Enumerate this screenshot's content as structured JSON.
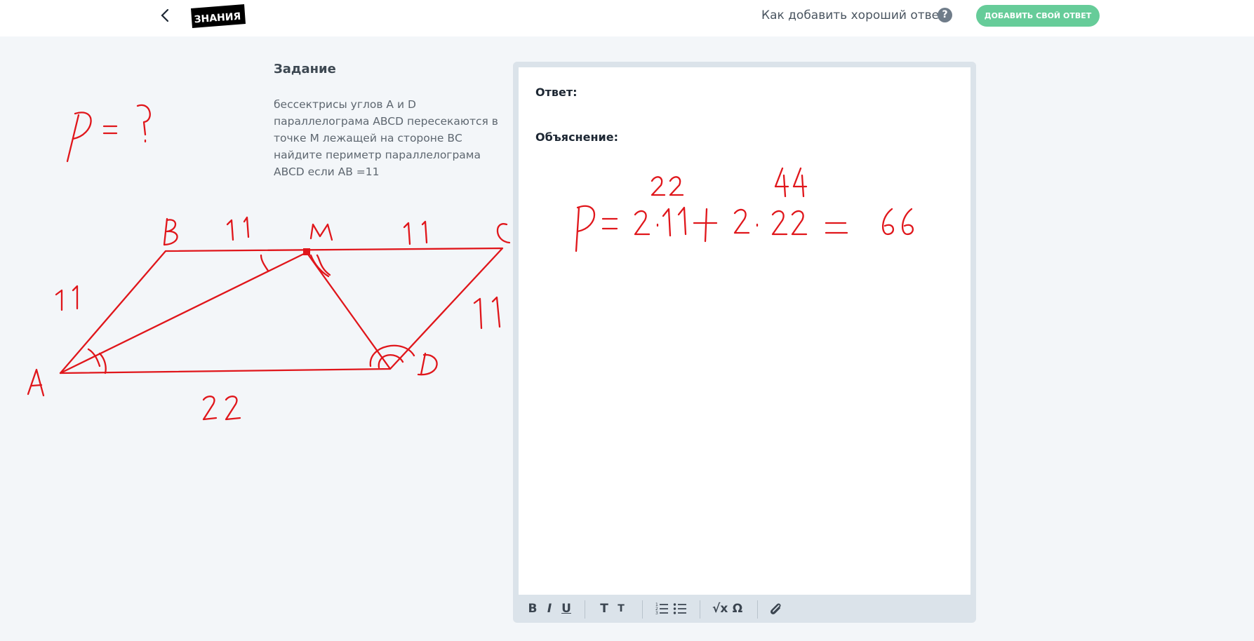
{
  "header": {
    "back_icon": "chevron-left-icon",
    "logo_text": "ЗНАНИЯ",
    "help_link": "Как добавить хороший ответ",
    "help_icon": "?",
    "add_button": "ДОБАВИТЬ СВОЙ ОТВЕТ"
  },
  "task": {
    "title": "Задание",
    "text": "бессектрисы углов А и D параллелограма ABCD пересекаются в точке М лежащей на стороне ВС найдите периметр параллелограма ABCD если АВ =11"
  },
  "drawing": {
    "formula": "P = ?",
    "vertices": [
      "A",
      "B",
      "M",
      "C",
      "D"
    ],
    "lengths": [
      "11",
      "11",
      "11",
      "11",
      "22"
    ]
  },
  "editor": {
    "answer_label": "Ответ:",
    "explanation_label": "Объяснение:",
    "handwriting": {
      "line": [
        "P",
        "=",
        "2",
        "·",
        "11",
        "+",
        "2",
        "·",
        "22",
        "=",
        "66"
      ],
      "above": [
        "22",
        "44"
      ]
    },
    "toolbar": {
      "bold": "B",
      "italic": "I",
      "underline": "U",
      "text_large": "T",
      "text_small": "T",
      "math": "√x",
      "symbol": "Ω",
      "ordered_list_icon": "ordered-list-icon",
      "bullet_list_icon": "bullet-list-icon",
      "attach_icon": "paperclip-icon"
    }
  },
  "colors": {
    "accent_button": "#66cc99",
    "ink": "#e0161b",
    "background": "#f3f6f9"
  }
}
